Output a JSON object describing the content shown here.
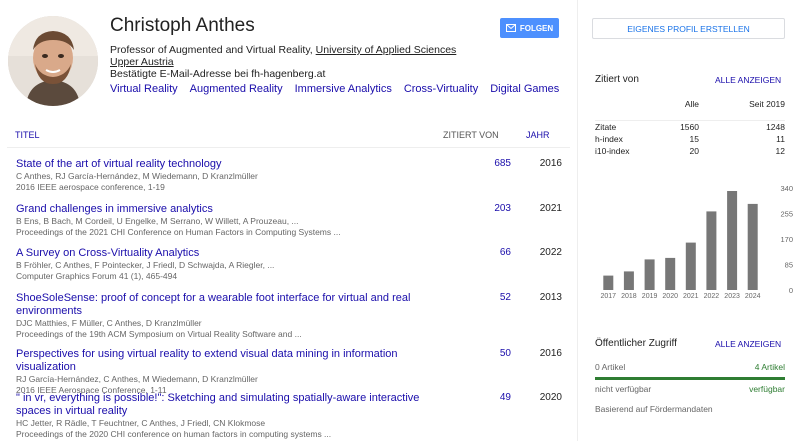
{
  "profile": {
    "name": "Christoph Anthes",
    "affiliation_prefix": "Professor of Augmented and Virtual Reality, ",
    "affiliation_link": "University of Applied Sciences Upper Austria",
    "email": "Bestätigte E-Mail-Adresse bei fh-hagenberg.at",
    "interests": [
      "Virtual Reality",
      "Augmented Reality",
      "Immersive Analytics",
      "Cross-Virtuality",
      "Digital Games"
    ],
    "follow_label": "FOLGEN"
  },
  "table": {
    "col_title": "TITEL",
    "col_cited": "ZITIERT VON",
    "col_year": "JAHR",
    "rows": [
      {
        "title": "State of the art of virtual reality technology",
        "authors": "C Anthes, RJ García-Hernández, M Wiedemann, D Kranzlmüller",
        "venue": "2016 IEEE aerospace conference, 1-19",
        "cites": "685",
        "year": "2016"
      },
      {
        "title": "Grand challenges in immersive analytics",
        "authors": "B Ens, B Bach, M Cordeil, U Engelke, M Serrano, W Willett, A Prouzeau, ...",
        "venue": "Proceedings of the 2021 CHI Conference on Human Factors in Computing Systems ...",
        "cites": "203",
        "year": "2021"
      },
      {
        "title": "A Survey on Cross-Virtuality Analytics",
        "authors": "B Fröhler, C Anthes, F Pointecker, J Friedl, D Schwajda, A Riegler, ...",
        "venue": "Computer Graphics Forum 41 (1), 465-494",
        "cites": "66",
        "year": "2022"
      },
      {
        "title": "ShoeSoleSense: proof of concept for a wearable foot interface for virtual and real environments",
        "authors": "DJC Matthies, F Müller, C Anthes, D Kranzlmüller",
        "venue": "Proceedings of the 19th ACM Symposium on Virtual Reality Software and ...",
        "cites": "52",
        "year": "2013"
      },
      {
        "title": "Perspectives for using virtual reality to extend visual data mining in information visualization",
        "authors": "RJ García-Hernández, C Anthes, M Wiedemann, D Kranzlmüller",
        "venue": "2016 IEEE Aerospace Conference, 1-11",
        "cites": "50",
        "year": "2016"
      },
      {
        "title": "\" in vr, everything is possible!\": Sketching and simulating spatially-aware interactive spaces in virtual reality",
        "authors": "HC Jetter, R Rädle, T Feuchtner, C Anthes, J Friedl, CN Klokmose",
        "venue": "Proceedings of the 2020 CHI conference on human factors in computing systems ...",
        "cites": "49",
        "year": "2020"
      }
    ]
  },
  "sidebar": {
    "create_profile_label": "EIGENES PROFIL ERSTELLEN",
    "cited_by_title": "Zitiert von",
    "show_all_label": "ALLE ANZEIGEN",
    "stats_col_all": "Alle",
    "stats_col_since": "Seit 2019",
    "stats": [
      {
        "label": "Zitate",
        "all": "1560",
        "since": "1248"
      },
      {
        "label": "h-index",
        "all": "15",
        "since": "11"
      },
      {
        "label": "i10-index",
        "all": "20",
        "since": "12"
      }
    ],
    "access_title": "Öffentlicher Zugriff",
    "access_show_all": "ALLE ANZEIGEN",
    "access_left": "0 Artikel",
    "access_right": "4 Artikel",
    "access_left_status": "nicht verfügbar",
    "access_right_status": "verfügbar",
    "access_note": "Basierend auf Fördermandaten",
    "colors": {
      "available": "#2e7d32",
      "bar": "#777777"
    }
  },
  "chart_data": {
    "type": "bar",
    "categories": [
      "2017",
      "2018",
      "2019",
      "2020",
      "2021",
      "2022",
      "2023",
      "2024"
    ],
    "values": [
      48,
      62,
      102,
      107,
      158,
      262,
      330,
      287
    ],
    "ylim": [
      0,
      340
    ],
    "yticks": [
      "340",
      "255",
      "170",
      "85",
      "0"
    ],
    "grid": false
  }
}
